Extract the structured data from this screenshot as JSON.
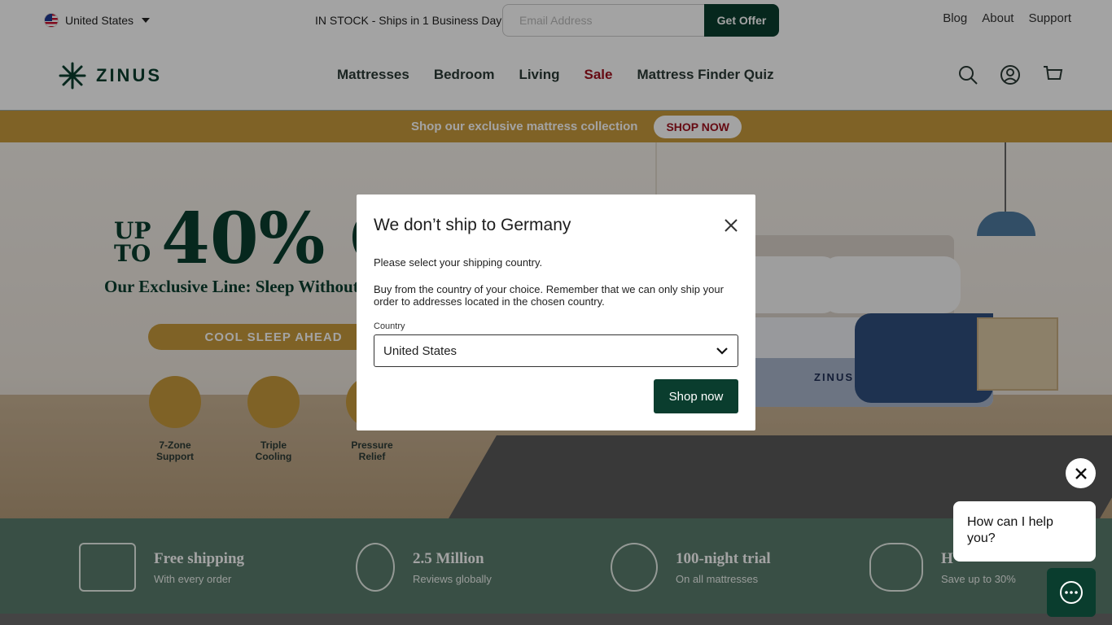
{
  "topbar": {
    "region_label": "United States",
    "stock_text": "IN STOCK - Ships in 1 Business Day",
    "email_placeholder": "Email Address",
    "offer_label": "Get Offer",
    "links": [
      "Blog",
      "About",
      "Support"
    ]
  },
  "nav": {
    "logo_text": "ZINUS",
    "links": [
      "Mattresses",
      "Bedroom",
      "Living",
      "Sale",
      "Mattress Finder Quiz"
    ],
    "icons": [
      "search-icon",
      "account-icon",
      "cart-icon"
    ]
  },
  "promo": {
    "text": "Shop our exclusive mattress collection",
    "button": "SHOP NOW"
  },
  "hero": {
    "upto": "UP TO",
    "big": "40% O",
    "sub": "Our Exclusive Line: Sleep Without C",
    "cta": "COOL SLEEP AHEAD",
    "features": [
      {
        "line1": "7-Zone",
        "line2": "Support"
      },
      {
        "line1": "Triple",
        "line2": "Cooling"
      },
      {
        "line1": "Pressure",
        "line2": "Relief"
      }
    ],
    "brand_mark": "ZINUS"
  },
  "benefits": [
    {
      "title": "Free shipping",
      "sub": "With every order",
      "icon": "truck-icon"
    },
    {
      "title": "2.5 Million",
      "sub": "Reviews globally",
      "icon": "ribbon-badge-icon"
    },
    {
      "title": "100-night trial",
      "sub": "On all mattresses",
      "icon": "moon-stars-icon"
    },
    {
      "title": "H",
      "sub": "Save up to 30%",
      "icon": "piggy-bank-icon"
    }
  ],
  "modal": {
    "title": "We don’t ship to Germany",
    "p1": "Please select your shipping country.",
    "p2": "Buy from the country of your choice. Remember that we can only ship your order to addresses located in the chosen country.",
    "country_label": "Country",
    "country_value": "United States",
    "button": "Shop now"
  },
  "chat": {
    "bubble": "How can I help you?"
  },
  "colors": {
    "brand_green": "#0a3d2e",
    "gold": "#c79a3c",
    "sale_red": "#a0121f",
    "benefit_green": "#5a7c6d"
  }
}
